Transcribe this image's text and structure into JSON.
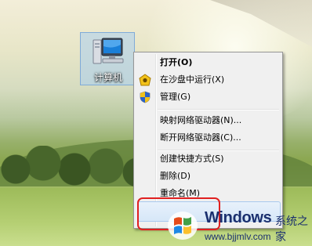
{
  "desktop": {
    "icon_label": "计算机"
  },
  "context_menu": {
    "items": [
      {
        "label": "打开(O)",
        "bold": true,
        "icon": ""
      },
      {
        "label": "在沙盘中运行(X)",
        "bold": false,
        "icon": "sandbox-icon"
      },
      {
        "label": "管理(G)",
        "bold": false,
        "icon": "shield-icon"
      },
      {
        "label": "映射网络驱动器(N)...",
        "bold": false,
        "icon": ""
      },
      {
        "label": "断开网络驱动器(C)...",
        "bold": false,
        "icon": ""
      },
      {
        "label": "创建快捷方式(S)",
        "bold": false,
        "icon": ""
      },
      {
        "label": "删除(D)",
        "bold": false,
        "icon": ""
      },
      {
        "label": "重命名(M)",
        "bold": false,
        "icon": ""
      }
    ]
  },
  "watermark": {
    "brand": "Windows",
    "sub": "系统之家",
    "url": "www.bjjmlv.com"
  },
  "colors": {
    "highlight_frame": "#e02020",
    "menu_bg": "#f0f0f0",
    "brand": "#1a2f6e"
  }
}
